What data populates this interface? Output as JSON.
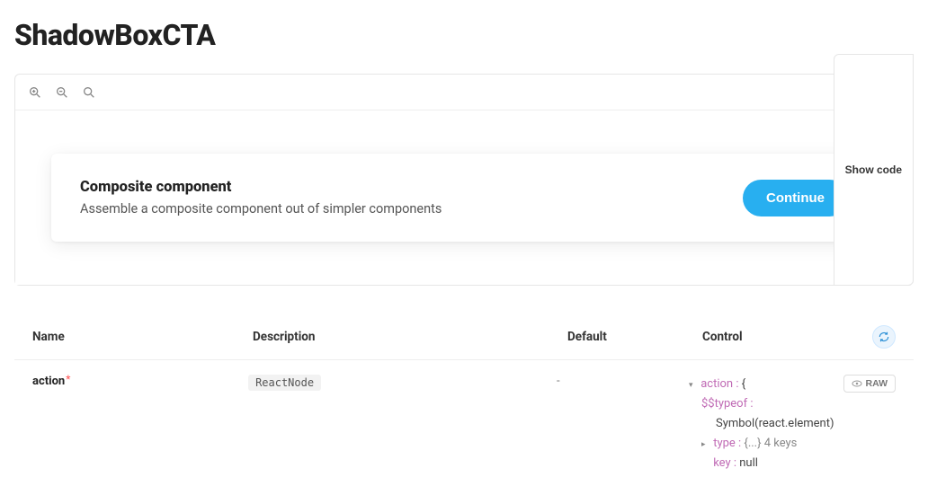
{
  "page_title": "ShadowBoxCTA",
  "preview": {
    "card_title": "Composite component",
    "card_desc": "Assemble a composite component out of simpler components",
    "cta_label": "Continue",
    "show_code_label": "Show code"
  },
  "args_table": {
    "headers": {
      "name": "Name",
      "description": "Description",
      "default_": "Default",
      "control": "Control"
    },
    "raw_label": "RAW",
    "row": {
      "name": "action",
      "required_mark": "*",
      "type_chip": "ReactNode",
      "default_display": "-",
      "ctrl": {
        "l1_key": "action",
        "l1_brace": "{",
        "l2_key": "$$typeof",
        "l2_val": "Symbol(react.element)",
        "l3_key": "type",
        "l3_summary": "{...} 4 keys",
        "l4_key": "key",
        "l4_val": "null"
      }
    }
  }
}
